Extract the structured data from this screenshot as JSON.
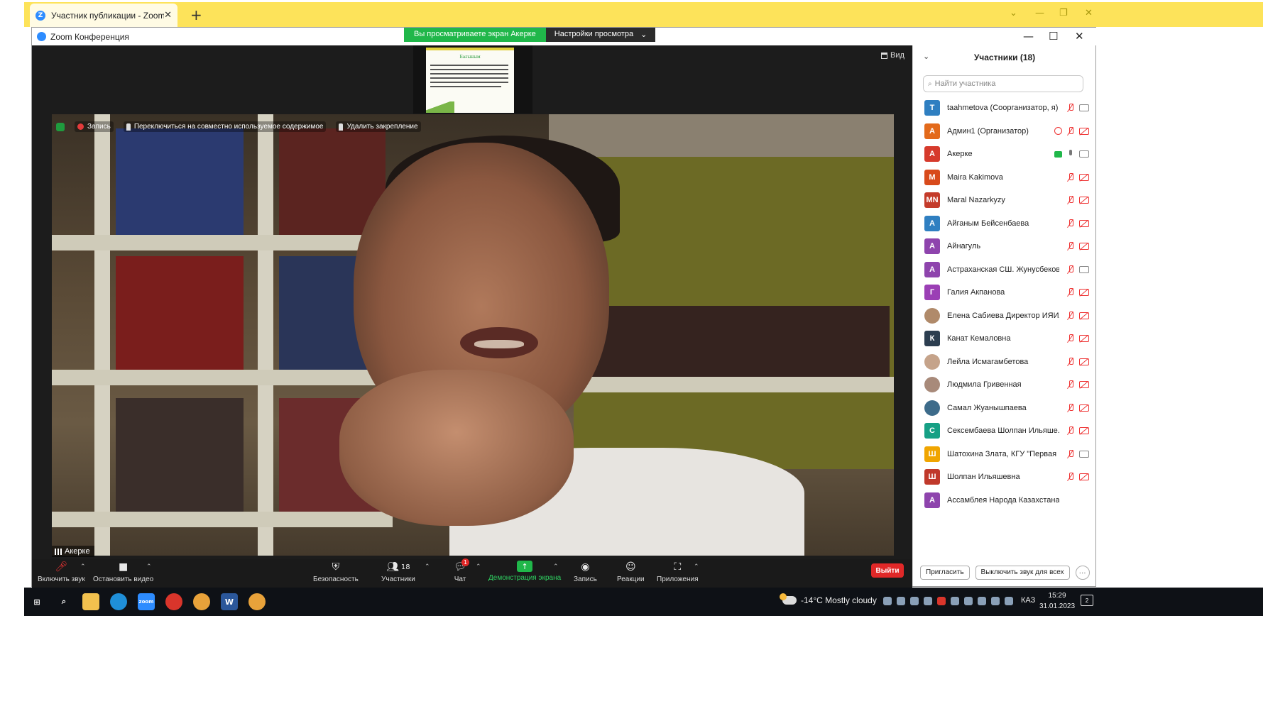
{
  "browser": {
    "tab_title": "Участник публикации - Zoom",
    "tab_close": "✕",
    "new_tab": "+",
    "controls": [
      "⌄",
      "—",
      "❐",
      "✕"
    ]
  },
  "zoom": {
    "window_title": "Zoom Конференция",
    "share_banner": "Вы просматриваете экран Акерке",
    "view_settings": "Настройки просмотра",
    "view_settings_caret": "⌄",
    "window_controls": [
      "—",
      "☐",
      "✕"
    ],
    "view_button": "Вид",
    "thumb_title": "Бағыным",
    "overlay": {
      "record": "Запись",
      "switch": "Переключиться на совместно используемое содержимое",
      "unpin": "Удалить закрепление"
    },
    "speaker": "Акерке"
  },
  "toolbar": {
    "mute": "Включить звук",
    "video": "Остановить видео",
    "security": "Безопасность",
    "participants": "Участники",
    "participants_count": "18",
    "chat": "Чат",
    "chat_badge": "1",
    "share": "Демонстрация экрана",
    "record": "Запись",
    "reactions": "Реакции",
    "apps": "Приложения",
    "leave": "Выйти",
    "caret": "⌃"
  },
  "panel": {
    "title": "Участники (18)",
    "collapse": "⌄",
    "search_placeholder": "Найти участника",
    "search_icon": "⌕",
    "invite": "Пригласить",
    "mute_all": "Выключить звук для всех",
    "more": "···",
    "participants": [
      {
        "initial": "T",
        "color": "#2f7fc1",
        "name": "taahmetova (Соорганизатор, я)",
        "mic": "off",
        "cam": "on"
      },
      {
        "initial": "А",
        "color": "#e36a1b",
        "name": "Админ1 (Организатор)",
        "mic": "off",
        "cam": "off",
        "host": true
      },
      {
        "initial": "А",
        "color": "#d63a2c",
        "name": "Акерке",
        "mic": "on",
        "cam": "on",
        "sharing": true
      },
      {
        "initial": "M",
        "color": "#d84a1b",
        "name": "Maira Kakimova",
        "mic": "off",
        "cam": "off"
      },
      {
        "initial": "MN",
        "color": "#c43b2a",
        "name": "Maral Nazarkyzy",
        "mic": "off",
        "cam": "off"
      },
      {
        "initial": "А",
        "color": "#2f7fc1",
        "name": "Айганым Бейсенбаева",
        "mic": "off",
        "cam": "off"
      },
      {
        "initial": "А",
        "color": "#8e44ad",
        "name": "Айнагуль",
        "mic": "off",
        "cam": "off"
      },
      {
        "initial": "А",
        "color": "#8e44ad",
        "name": "Астраханская СШ. Жунусбеков...",
        "mic": "off",
        "cam": "on"
      },
      {
        "initial": "Г",
        "color": "#9b3fb5",
        "name": "Галия Акпанова",
        "mic": "off",
        "cam": "off"
      },
      {
        "initial": "",
        "color": "#b08a6a",
        "name": "Елена Сабиева Директор ИЯИЛ",
        "mic": "off",
        "cam": "off",
        "photo": true
      },
      {
        "initial": "К",
        "color": "#2c3e50",
        "name": "Канат Кемаловна",
        "mic": "off",
        "cam": "off"
      },
      {
        "initial": "",
        "color": "#c5a38a",
        "name": "Лейла Исмагамбетова",
        "mic": "off",
        "cam": "off",
        "photo": true
      },
      {
        "initial": "",
        "color": "#a88a7a",
        "name": "Людмила Гривенная",
        "mic": "off",
        "cam": "off",
        "photo": true
      },
      {
        "initial": "",
        "color": "#3d6b8a",
        "name": "Самал Жуанышпаева",
        "mic": "off",
        "cam": "off",
        "photo": true
      },
      {
        "initial": "С",
        "color": "#16a085",
        "name": "Сексембаева Шолпан Ильяше...",
        "mic": "off",
        "cam": "off"
      },
      {
        "initial": "Ш",
        "color": "#f0a500",
        "name": "Шатохина Злата, КГУ \"Первая Г...",
        "mic": "off",
        "cam": "on"
      },
      {
        "initial": "Ш",
        "color": "#c0392b",
        "name": "Шолпан Ильяшевна",
        "mic": "off",
        "cam": "off"
      },
      {
        "initial": "А",
        "color": "#8e44ad",
        "name": "Ассамблея Народа Казахстана",
        "mic": "none",
        "cam": "none"
      }
    ]
  },
  "taskbar": {
    "weather": "-14°C  Mostly cloudy",
    "lang": "КАЗ",
    "time": "15:29",
    "date": "31.01.2023",
    "notify_count": "2",
    "zoom_label": "zoom",
    "word_label": "W"
  }
}
